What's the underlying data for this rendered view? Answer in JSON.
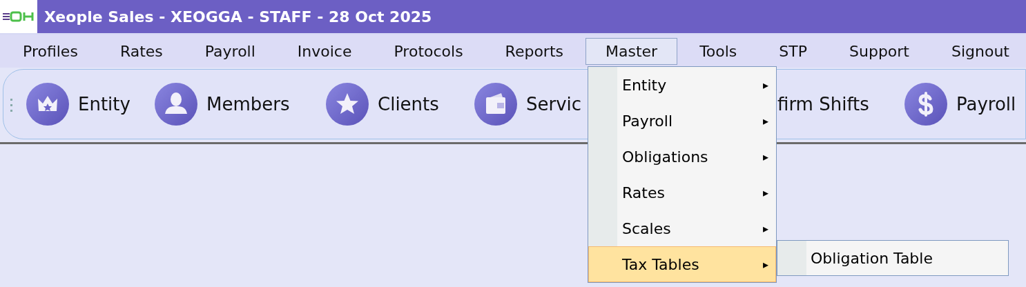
{
  "window": {
    "title": "Xeople Sales - XEOGGA - STAFF - 28 Oct 2025"
  },
  "menu_bar": [
    {
      "label": "Profiles",
      "selected": false
    },
    {
      "label": "Rates",
      "selected": false
    },
    {
      "label": "Payroll",
      "selected": false
    },
    {
      "label": "Invoice",
      "selected": false
    },
    {
      "label": "Protocols",
      "selected": false
    },
    {
      "label": "Reports",
      "selected": false
    },
    {
      "label": "Master",
      "selected": true
    },
    {
      "label": "Tools",
      "selected": false
    },
    {
      "label": "STP",
      "selected": false
    },
    {
      "label": "Support",
      "selected": false
    },
    {
      "label": "Signout",
      "selected": false
    }
  ],
  "toolbar": [
    {
      "label": "Entity"
    },
    {
      "label": "Members"
    },
    {
      "label": "Clients"
    },
    {
      "label": "Servic"
    },
    {
      "label": "firm Shifts"
    },
    {
      "label": "Payroll"
    }
  ],
  "master_menu": [
    {
      "label": "Entity",
      "selected": false,
      "submenu_arrow": "▸"
    },
    {
      "label": "Payroll",
      "selected": false,
      "submenu_arrow": "▸"
    },
    {
      "label": "Obligations",
      "selected": false,
      "submenu_arrow": "▸"
    },
    {
      "label": "Rates",
      "selected": false,
      "submenu_arrow": "▸"
    },
    {
      "label": "Scales",
      "selected": false,
      "submenu_arrow": "▸"
    },
    {
      "label": "Tax Tables",
      "selected": true,
      "submenu_arrow": "▸"
    }
  ],
  "tax_tables_submenu": [
    {
      "label": "Obligation Table"
    }
  ]
}
